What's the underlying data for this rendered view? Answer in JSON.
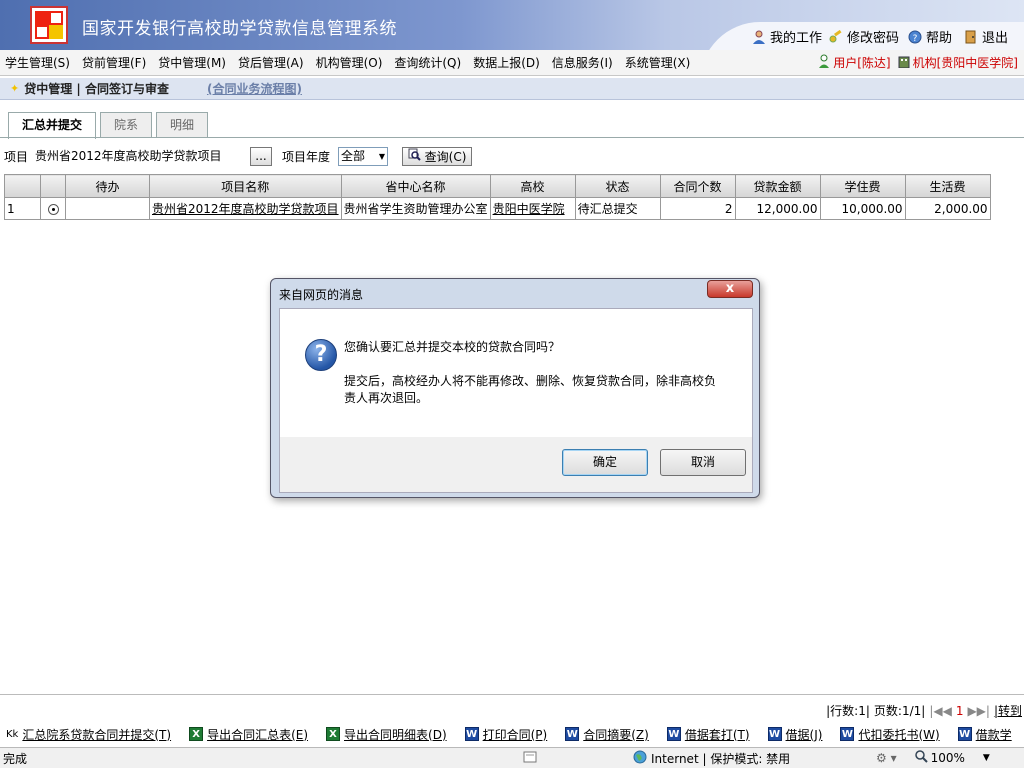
{
  "header": {
    "title": "国家开发银行高校助学贷款信息管理系统",
    "links": [
      "我的工作",
      "修改密码",
      "帮助",
      "退出"
    ]
  },
  "menu": [
    "学生管理(S)",
    "贷前管理(F)",
    "贷中管理(M)",
    "贷后管理(A)",
    "机构管理(O)",
    "查询统计(Q)",
    "数据上报(D)",
    "信息服务(I)",
    "系统管理(X)"
  ],
  "user": {
    "label": "用户[陈达]",
    "org": "机构[贵阳中医学院]"
  },
  "breadcrumb": {
    "path": "贷中管理 | 合同签订与审查",
    "flow_link": "(合同业务流程图)"
  },
  "tabs": [
    "汇总并提交",
    "院系",
    "明细"
  ],
  "filter": {
    "project_label": "项目",
    "project_value": "贵州省2012年度高校助学贷款项目",
    "more_btn": "...",
    "year_label": "项目年度",
    "year_value": "全部",
    "query_btn": "查询(C)"
  },
  "grid": {
    "headers": [
      "",
      "",
      "待办",
      "项目名称",
      "省中心名称",
      "高校",
      "状态",
      "合同个数",
      "贷款金额",
      "学住费",
      "生活费"
    ],
    "rows": [
      [
        "1",
        "",
        "",
        "贵州省2012年度高校助学贷款项目",
        "贵州省学生资助管理办公室",
        "贵阳中医学院",
        "待汇总提交",
        "2",
        "12,000.00",
        "10,000.00",
        "2,000.00"
      ]
    ]
  },
  "dialog": {
    "title": "来自网页的消息",
    "close": "x",
    "question": "您确认要汇总并提交本校的贷款合同吗？",
    "note": "提交后，高校经办人将不能再修改、删除、恢复贷款合同，除非高校负责人再次退回。",
    "ok": "确定",
    "cancel": "取消"
  },
  "pager": {
    "rows": "|行数:1|",
    "pages": "页数:1/1|",
    "current": "1",
    "goto": "|转到"
  },
  "actions": [
    "汇总院系贷款合同并提交(T)",
    "导出合同汇总表(E)",
    "导出合同明细表(D)",
    "打印合同(P)",
    "合同摘要(Z)",
    "借据套打(T)",
    "借据(J)",
    "代扣委托书(W)",
    "借款学"
  ],
  "status": {
    "left": "完成",
    "zone": "Internet | 保护模式: 禁用",
    "zoom": "100%"
  }
}
